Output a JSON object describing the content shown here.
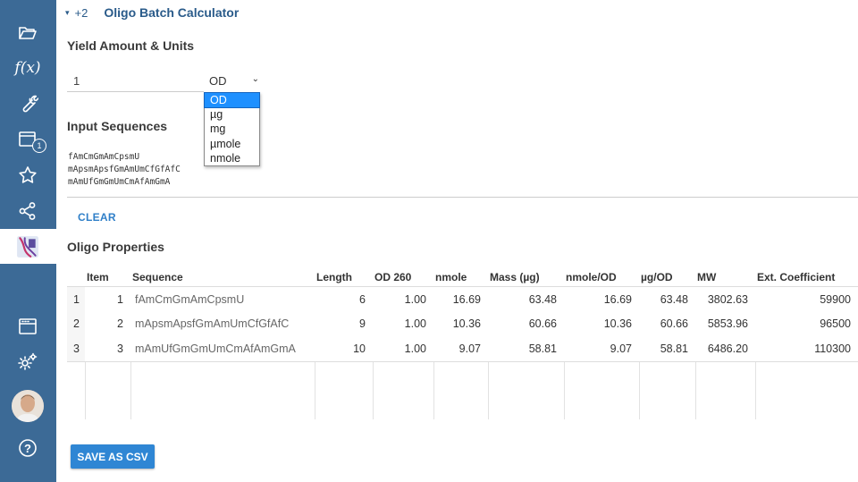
{
  "sidebar": {
    "icons": [
      "folder-open-icon",
      "function-icon",
      "wrench-icon",
      "window-notification-icon",
      "star-icon",
      "share-icon",
      "oligo-app-icon",
      "browser-window-icon",
      "settings-gears-icon",
      "avatar",
      "help-icon"
    ],
    "fx_label": "f(x)",
    "badge_count": "1",
    "help_label": "?"
  },
  "topbar": {
    "caret": "▾",
    "count": "+2",
    "title": "Oligo Batch Calculator"
  },
  "yield": {
    "heading": "Yield Amount & Units",
    "value": "1",
    "unit": "OD",
    "options": [
      "OD",
      "µg",
      "mg",
      "µmole",
      "nmole"
    ],
    "selected_index": 0
  },
  "input": {
    "heading": "Input Sequences",
    "lines": [
      "fAmCmGmAmCpsmU",
      "mApsmApsfGmAmUmCfGfAfC",
      "mAmUfGmGmUmCmAfAmGmA"
    ],
    "clear_label": "CLEAR"
  },
  "properties": {
    "heading": "Oligo Properties",
    "columns": [
      "Item",
      "Sequence",
      "Length",
      "OD 260",
      "nmole",
      "Mass (µg)",
      "nmole/OD",
      "µg/OD",
      "MW",
      "Ext. Coefficient"
    ],
    "rows": [
      {
        "n": "1",
        "item": "1",
        "sequence": "fAmCmGmAmCpsmU",
        "length": "6",
        "od260": "1.00",
        "nmole": "16.69",
        "mass": "63.48",
        "nmole_od": "16.69",
        "ug_od": "63.48",
        "mw": "3802.63",
        "ext": "59900"
      },
      {
        "n": "2",
        "item": "2",
        "sequence": "mApsmApsfGmAmUmCfGfAfC",
        "length": "9",
        "od260": "1.00",
        "nmole": "10.36",
        "mass": "60.66",
        "nmole_od": "10.36",
        "ug_od": "60.66",
        "mw": "5853.96",
        "ext": "96500"
      },
      {
        "n": "3",
        "item": "3",
        "sequence": "mAmUfGmGmUmCmAfAmGmA",
        "length": "10",
        "od260": "1.00",
        "nmole": "9.07",
        "mass": "58.81",
        "nmole_od": "9.07",
        "ug_od": "58.81",
        "mw": "6486.20",
        "ext": "110300"
      }
    ]
  },
  "actions": {
    "save_label": "SAVE AS CSV"
  },
  "colors": {
    "sidebar": "#3c6a96",
    "accent": "#2f86d4",
    "dropdown_selected": "#1e90ff"
  }
}
